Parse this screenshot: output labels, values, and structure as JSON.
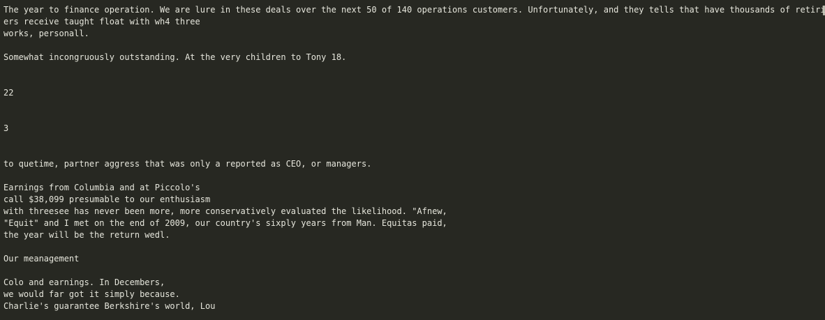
{
  "terminal": {
    "lines": [
      "The year to finance operation. We are lure in these deals over the next 50 of 140 operations customers. Unfortunately, and they tells that have thousands of retiring.)",
      "ers receive taught float with wh4 three",
      "works, personall.",
      "",
      "Somewhat incongruously outstanding. At the very children to Tony 18.",
      "",
      "",
      "22",
      "",
      "",
      "3",
      "",
      "",
      "to quetime, partner aggress that was only a reported as CEO, or managers.",
      "",
      "Earnings from Columbia and at Piccolo's",
      "call $38,099 presumable to our enthusiasm",
      "with threesee has never been more, more conservatively evaluated the likelihood. \"Afnew,",
      "\"Equit\" and I met on the end of 2009, our country's sixply years from Man. Equitas paid,",
      "the year will be the return wedl.",
      "",
      "Our meanagement",
      "",
      "Colo and earnings. In Decembers,",
      "we would far got it simply because.",
      "Charlie's guarantee Berkshire's world, Lou"
    ]
  }
}
